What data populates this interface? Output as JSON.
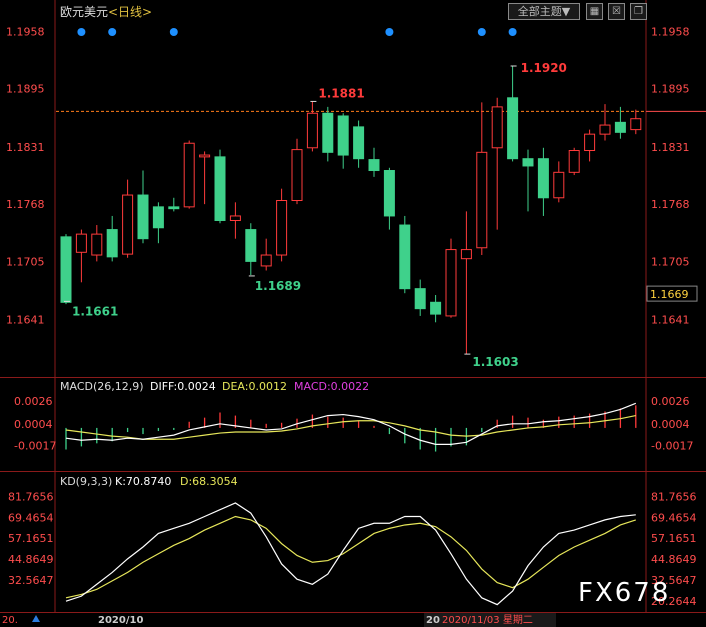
{
  "header": {
    "symbol": "欧元美元",
    "period": "<日线>",
    "theme_button": "全部主题▼",
    "tool_icons": [
      "grid-icon",
      "close-box-icon",
      "restore-icon"
    ]
  },
  "colors": {
    "up": "#ff3b3b",
    "down": "#3fd18b",
    "axis_price": "#ff4d4d",
    "current_line": "#ff7b1a",
    "grid_dash": "#c8102e",
    "diff": "#ffffff",
    "dea": "#e6e65a",
    "macd_label": "#e040e0",
    "dot": "#1e90ff"
  },
  "price_panel": {
    "y_ticks": [
      "1.1958",
      "1.1895",
      "1.1831",
      "1.1768",
      "1.1705",
      "1.1641"
    ],
    "current_price": "1.1669",
    "annotations": {
      "low_left": "1.1661",
      "high_mid": "1.1881",
      "low_mid": "1.1689",
      "low_bottom": "1.1603",
      "high_right": "1.1920"
    }
  },
  "macd_panel": {
    "label": "MACD(26,12,9)",
    "diff_text": "DIFF:0.0024",
    "dea_text": "DEA:0.0012",
    "macd_text": "MACD:0.0022",
    "y_ticks": [
      "0.0026",
      "0.0004",
      "-0.0017"
    ]
  },
  "kd_panel": {
    "label": "KD(9,3,3)",
    "k_text": "K:70.8740",
    "d_text": "D:68.3054",
    "y_ticks": [
      "81.7656",
      "69.4654",
      "57.1651",
      "44.8649",
      "32.5647",
      "20.2644"
    ]
  },
  "x_axis": {
    "left_date": "2020/10",
    "cursor_date": "2020/11/03 星期二",
    "cursor_prefix": "20",
    "corner_value": "20."
  },
  "watermark": "FX678",
  "chart_data": {
    "type": "candlestick",
    "title": "欧元美元 <日线>",
    "ylim": [
      1.158,
      1.1975
    ],
    "candles": [
      {
        "o": 1.1732,
        "h": 1.1735,
        "l": 1.1658,
        "c": 1.166
      },
      {
        "o": 1.1715,
        "h": 1.174,
        "l": 1.1682,
        "c": 1.1735
      },
      {
        "o": 1.1712,
        "h": 1.1745,
        "l": 1.1705,
        "c": 1.1735
      },
      {
        "o": 1.174,
        "h": 1.1755,
        "l": 1.1705,
        "c": 1.171
      },
      {
        "o": 1.1713,
        "h": 1.1795,
        "l": 1.1709,
        "c": 1.1778
      },
      {
        "o": 1.1778,
        "h": 1.1805,
        "l": 1.1725,
        "c": 1.173
      },
      {
        "o": 1.1765,
        "h": 1.177,
        "l": 1.1725,
        "c": 1.1742
      },
      {
        "o": 1.1765,
        "h": 1.1775,
        "l": 1.176,
        "c": 1.1763
      },
      {
        "o": 1.1765,
        "h": 1.1838,
        "l": 1.1763,
        "c": 1.1835
      },
      {
        "o": 1.182,
        "h": 1.1826,
        "l": 1.1768,
        "c": 1.1822
      },
      {
        "o": 1.182,
        "h": 1.1828,
        "l": 1.1747,
        "c": 1.175
      },
      {
        "o": 1.175,
        "h": 1.177,
        "l": 1.173,
        "c": 1.1755
      },
      {
        "o": 1.174,
        "h": 1.1747,
        "l": 1.169,
        "c": 1.1705
      },
      {
        "o": 1.17,
        "h": 1.173,
        "l": 1.1695,
        "c": 1.1712
      },
      {
        "o": 1.1712,
        "h": 1.1785,
        "l": 1.1705,
        "c": 1.1772
      },
      {
        "o": 1.1772,
        "h": 1.184,
        "l": 1.1768,
        "c": 1.1828
      },
      {
        "o": 1.183,
        "h": 1.1881,
        "l": 1.1826,
        "c": 1.1868
      },
      {
        "o": 1.1868,
        "h": 1.1875,
        "l": 1.1815,
        "c": 1.1825
      },
      {
        "o": 1.1865,
        "h": 1.1868,
        "l": 1.1807,
        "c": 1.1822
      },
      {
        "o": 1.1853,
        "h": 1.186,
        "l": 1.1808,
        "c": 1.1818
      },
      {
        "o": 1.1817,
        "h": 1.183,
        "l": 1.1798,
        "c": 1.1805
      },
      {
        "o": 1.1805,
        "h": 1.1808,
        "l": 1.174,
        "c": 1.1755
      },
      {
        "o": 1.1745,
        "h": 1.1755,
        "l": 1.167,
        "c": 1.1675
      },
      {
        "o": 1.1675,
        "h": 1.1685,
        "l": 1.1645,
        "c": 1.1653
      },
      {
        "o": 1.166,
        "h": 1.1668,
        "l": 1.1638,
        "c": 1.1647
      },
      {
        "o": 1.1645,
        "h": 1.173,
        "l": 1.1643,
        "c": 1.1718
      },
      {
        "o": 1.1708,
        "h": 1.176,
        "l": 1.1603,
        "c": 1.1718
      },
      {
        "o": 1.172,
        "h": 1.188,
        "l": 1.1712,
        "c": 1.1825
      },
      {
        "o": 1.183,
        "h": 1.1885,
        "l": 1.174,
        "c": 1.1875
      },
      {
        "o": 1.1885,
        "h": 1.192,
        "l": 1.1815,
        "c": 1.1818
      },
      {
        "o": 1.1818,
        "h": 1.1828,
        "l": 1.176,
        "c": 1.181
      },
      {
        "o": 1.1818,
        "h": 1.183,
        "l": 1.1755,
        "c": 1.1775
      },
      {
        "o": 1.1775,
        "h": 1.1815,
        "l": 1.177,
        "c": 1.1803
      },
      {
        "o": 1.1803,
        "h": 1.183,
        "l": 1.18,
        "c": 1.1827
      },
      {
        "o": 1.1827,
        "h": 1.185,
        "l": 1.1815,
        "c": 1.1845
      },
      {
        "o": 1.1845,
        "h": 1.1878,
        "l": 1.1838,
        "c": 1.1855
      },
      {
        "o": 1.1858,
        "h": 1.1875,
        "l": 1.184,
        "c": 1.1847
      },
      {
        "o": 1.185,
        "h": 1.1872,
        "l": 1.1845,
        "c": 1.1862
      }
    ],
    "current_price": 1.1669,
    "marker_candles": [
      1,
      3,
      7,
      21,
      27,
      29
    ],
    "macd": {
      "ylim": [
        -0.004,
        0.0034
      ],
      "histogram": [
        -0.0021,
        -0.0018,
        -0.0015,
        -0.0013,
        -0.0004,
        -0.0006,
        -0.0003,
        -0.0002,
        0.0006,
        0.001,
        0.0015,
        0.0012,
        0.0008,
        0.0004,
        0.0005,
        0.0009,
        0.0013,
        0.0011,
        0.001,
        0.0007,
        0.0002,
        -0.0006,
        -0.0015,
        -0.0021,
        -0.0023,
        -0.0018,
        -0.0017,
        -0.0004,
        0.0008,
        0.0012,
        0.001,
        0.0008,
        0.0011,
        0.0012,
        0.0014,
        0.0016,
        0.0019,
        0.0022
      ],
      "diff": [
        -0.001,
        -0.0012,
        -0.0011,
        -0.0012,
        -0.001,
        -0.0011,
        -0.0009,
        -0.0007,
        -0.0002,
        0.0001,
        0.0004,
        0.0002,
        0.0,
        -0.0002,
        -0.0001,
        0.0004,
        0.0008,
        0.0012,
        0.0013,
        0.0011,
        0.0008,
        0.0002,
        -0.0006,
        -0.0012,
        -0.0016,
        -0.0016,
        -0.0014,
        -0.0006,
        0.0002,
        0.0004,
        0.0004,
        0.0006,
        0.0007,
        0.0009,
        0.0011,
        0.0014,
        0.0018,
        0.0024
      ],
      "dea": [
        -0.0002,
        -0.0004,
        -0.0006,
        -0.0008,
        -0.0009,
        -0.0011,
        -0.0011,
        -0.0011,
        -0.0009,
        -0.0007,
        -0.0005,
        -0.0004,
        -0.0004,
        -0.0004,
        -0.0003,
        -0.0001,
        0.0002,
        0.0004,
        0.0006,
        0.0007,
        0.0007,
        0.0005,
        0.0002,
        -0.0002,
        -0.0004,
        -0.0007,
        -0.0008,
        -0.0007,
        -0.0004,
        -0.0002,
        0.0,
        0.0001,
        0.0003,
        0.0004,
        0.0005,
        0.0007,
        0.0009,
        0.0012
      ]
    },
    "kd": {
      "ylim": [
        16,
        88
      ],
      "k": [
        20,
        23,
        30,
        37,
        45,
        52,
        60,
        63,
        66,
        70,
        74,
        78,
        72,
        58,
        42,
        33,
        30,
        36,
        50,
        63,
        66,
        66,
        70,
        70,
        62,
        48,
        33,
        22,
        18,
        26,
        41,
        52,
        60,
        62,
        65,
        68,
        70,
        71
      ],
      "d": [
        22,
        24,
        27,
        32,
        37,
        43,
        48,
        53,
        57,
        62,
        66,
        70,
        68,
        63,
        54,
        47,
        43,
        44,
        48,
        54,
        60,
        63,
        65,
        66,
        64,
        58,
        50,
        39,
        31,
        28,
        33,
        40,
        47,
        52,
        56,
        60,
        65,
        68
      ]
    }
  }
}
